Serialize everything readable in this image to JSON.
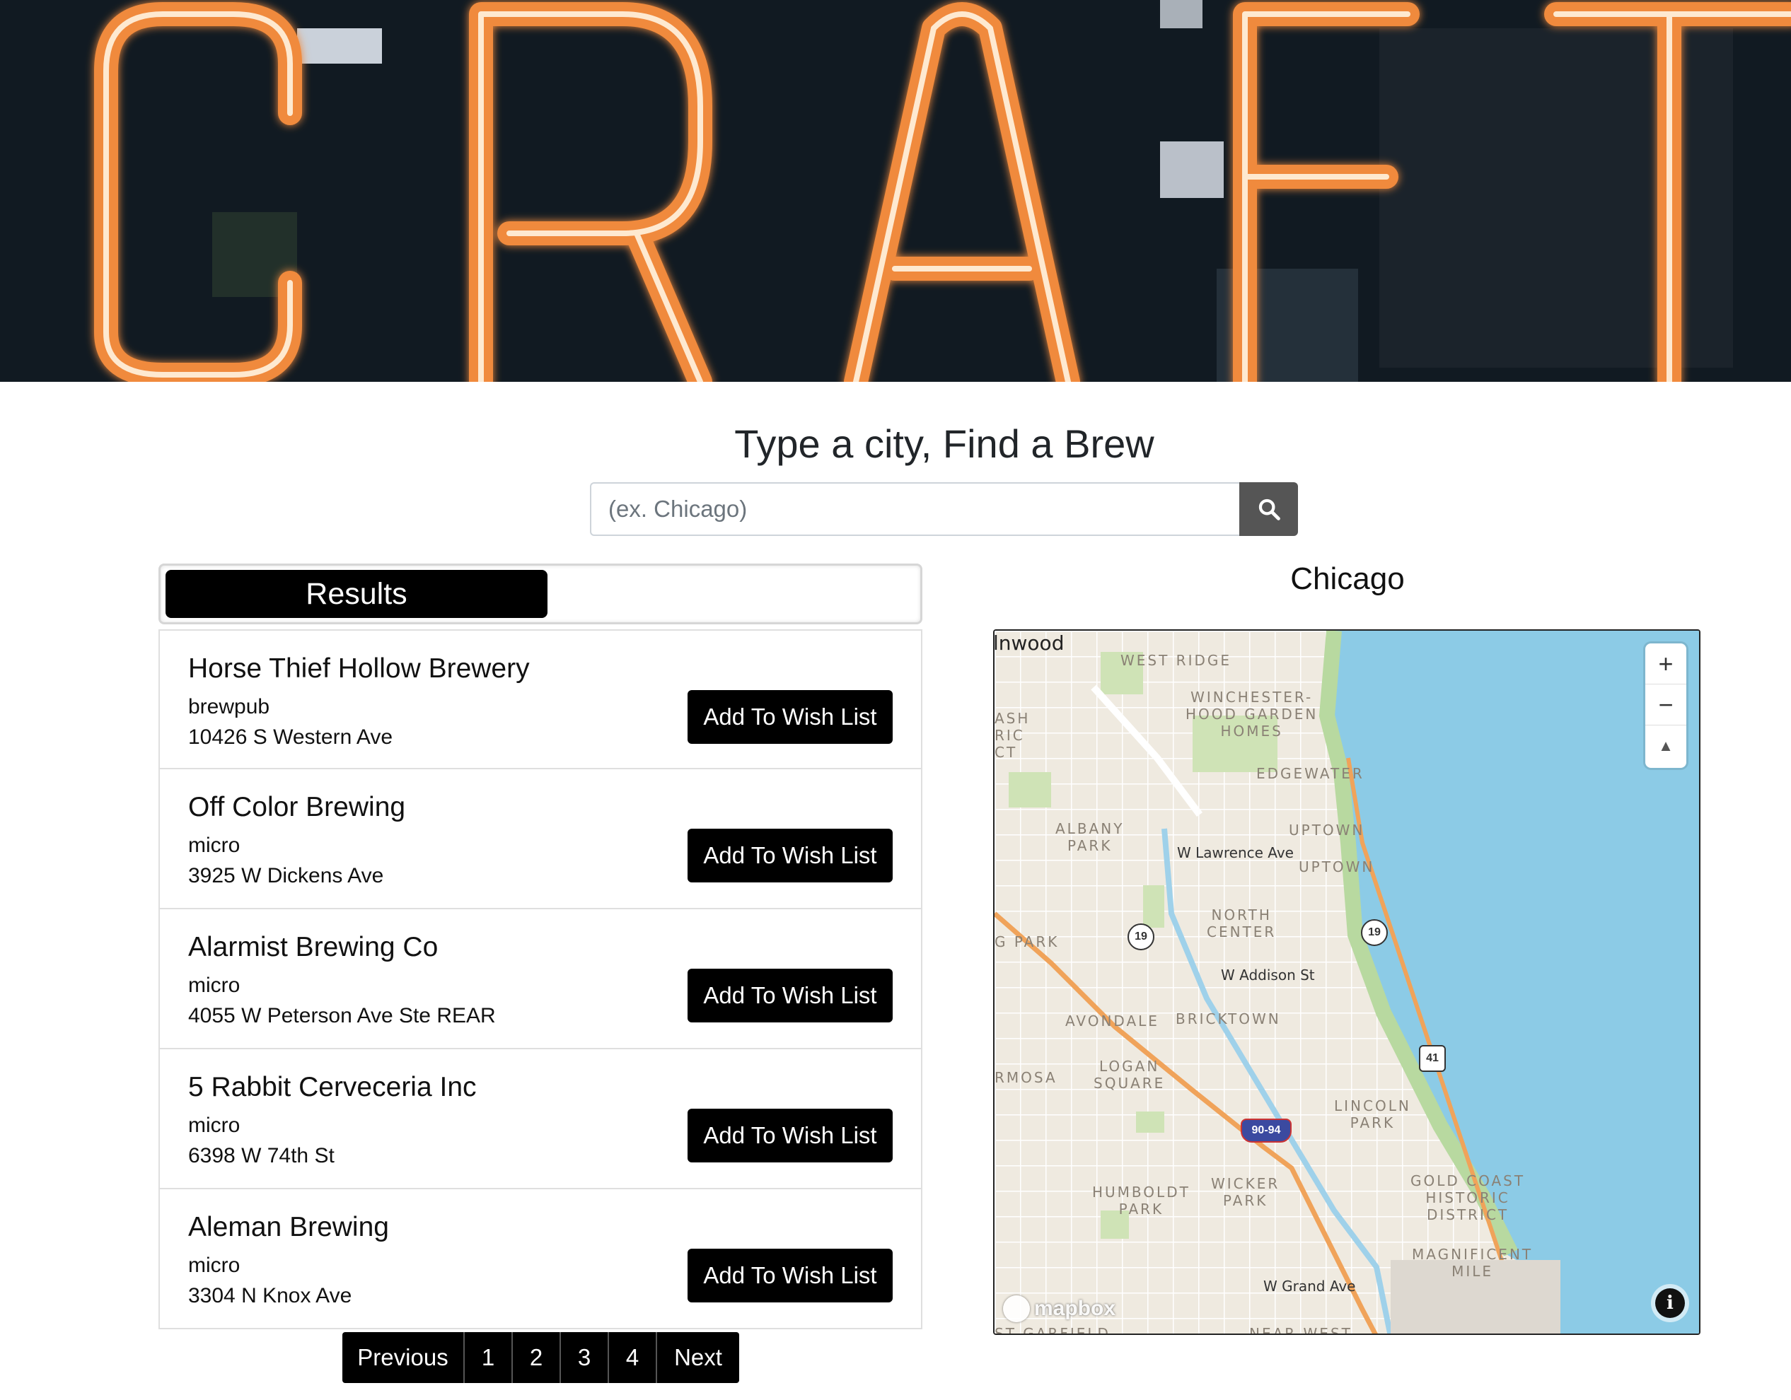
{
  "hero": {
    "sign_text": "CRAFT",
    "colors": {
      "neon": "#f08a3c",
      "neon_core": "#fff3e0",
      "background": "#101820"
    }
  },
  "search": {
    "title": "Type a city, Find a Brew",
    "placeholder": "(ex. Chicago)",
    "button_icon": "search-icon"
  },
  "results": {
    "tab_label": "Results",
    "items": [
      {
        "name": "Horse Thief Hollow Brewery",
        "type": "brewpub",
        "address": "10426 S Western Ave",
        "button": "Add To Wish List"
      },
      {
        "name": "Off Color Brewing",
        "type": "micro",
        "address": "3925 W Dickens Ave",
        "button": "Add To Wish List"
      },
      {
        "name": "Alarmist Brewing Co",
        "type": "micro",
        "address": "4055 W Peterson Ave Ste REAR",
        "button": "Add To Wish List"
      },
      {
        "name": "5 Rabbit Cerveceria Inc",
        "type": "micro",
        "address": "6398 W 74th St",
        "button": "Add To Wish List"
      },
      {
        "name": "Aleman Brewing",
        "type": "micro",
        "address": "3304 N Knox Ave",
        "button": "Add To Wish List"
      }
    ]
  },
  "pagination": {
    "previous": "Previous",
    "pages": [
      "1",
      "2",
      "3",
      "4"
    ],
    "next": "Next"
  },
  "map": {
    "city": "Chicago",
    "zoom_in": "+",
    "zoom_out": "−",
    "compass": "▲",
    "info": "i",
    "attribution": "mapbox",
    "colors": {
      "water": "#8ccbe6",
      "land": "#efeae0",
      "park": "#cfe3b6",
      "highway": "#f0a35a"
    },
    "labels": {
      "lnwood": "lnwood",
      "west_ridge": "WEST RIDGE",
      "winchester": "WINCHESTER-\nHOOD GARDEN\nHOMES",
      "ash": "ASH\nRIC\nCT",
      "edgewater": "EDGEWATER",
      "albany": "ALBANY\nPARK",
      "uptown1": "UPTOWN",
      "uptown2": "UPTOWN",
      "lawrence": "W Lawrence Ave",
      "north_center": "NORTH\nCENTER",
      "g_park": "G PARK",
      "addison": "W Addison St",
      "avondale": "AVONDALE",
      "bricktown": "BRICKTOWN",
      "rmosa": "RMOSA",
      "logan": "LOGAN\nSQUARE",
      "lincoln": "LINCOLN\nPARK",
      "humboldt": "HUMBOLDT\nPARK",
      "wicker": "WICKER\nPARK",
      "gold_coast": "GOLD COAST\nHISTORIC\nDISTRICT",
      "magnificent": "MAGNIFICENT\nMILE",
      "grand": "W Grand Ave",
      "garfield": "ST GARFIELD",
      "near_west": "NEAR WEST",
      "shield19a": "19",
      "shield19b": "19",
      "shield41": "41",
      "shield9094": "90-94"
    }
  }
}
